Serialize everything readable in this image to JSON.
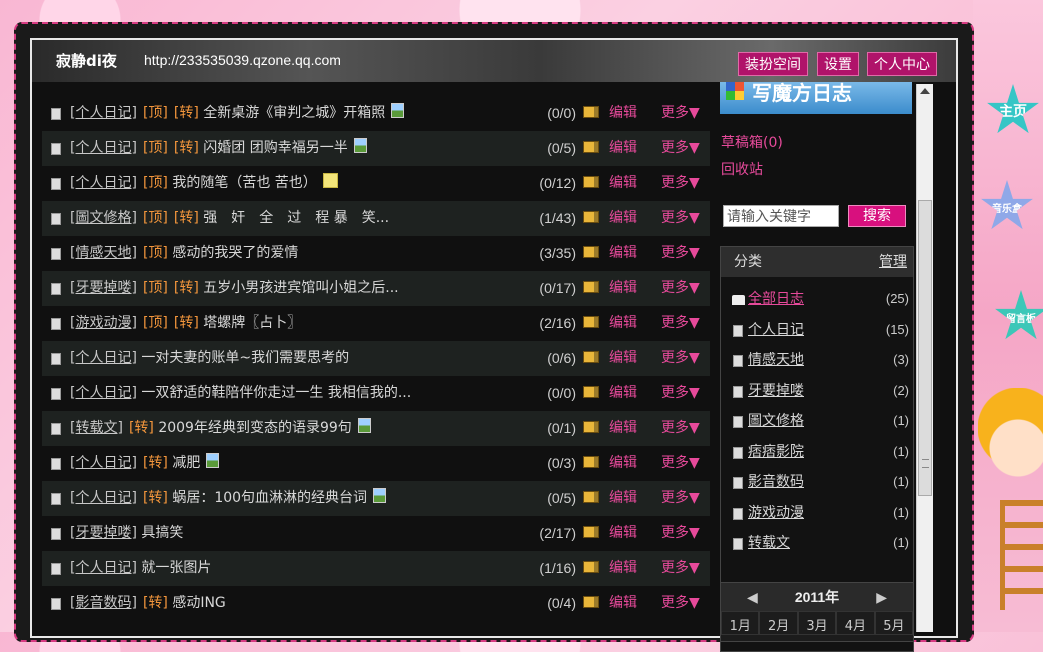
{
  "header": {
    "brand": "寂静di夜",
    "url": "http://233535039.qzone.qq.com",
    "buttons": [
      "装扮空间",
      "设置",
      "个人中心"
    ]
  },
  "nav_stars": [
    "主页",
    "音乐盒",
    "留言板"
  ],
  "blog_list": [
    {
      "category": "[个人日记]",
      "tags": [
        "[顶]",
        "[转]"
      ],
      "title": "全新桌游《审判之城》开箱照",
      "count": "(0/0)"
    },
    {
      "category": "[个人日记]",
      "tags": [
        "[顶]",
        "[转]"
      ],
      "title": "闪婚团 团购幸福另一半",
      "count": "(0/5)"
    },
    {
      "category": "[个人日记]",
      "tags": [
        "[顶]"
      ],
      "title": "我的随笔（苦也 苦也）",
      "count": "(0/12)"
    },
    {
      "category": "[圖文修格]",
      "tags": [
        "[顶]",
        "[转]"
      ],
      "title": "强　奸　全　过　程 暴　笑...",
      "count": "(1/43)"
    },
    {
      "category": "[情感天地]",
      "tags": [
        "[顶]"
      ],
      "title": "感动的我哭了的爱情",
      "count": "(3/35)"
    },
    {
      "category": "[牙要掉喽]",
      "tags": [
        "[顶]",
        "[转]"
      ],
      "title": "五岁小男孩进宾馆叫小姐之后...",
      "count": "(0/17)"
    },
    {
      "category": "[游戏动漫]",
      "tags": [
        "[顶]",
        "[转]"
      ],
      "title": "塔螺牌〖占卜〗",
      "count": "(2/16)"
    },
    {
      "category": "[个人日记]",
      "tags": [],
      "title": "一对夫妻的账单~我们需要思考的",
      "count": "(0/6)"
    },
    {
      "category": "[个人日记]",
      "tags": [],
      "title": "一双舒适的鞋陪伴你走过一生 我相信我的...",
      "count": "(0/0)"
    },
    {
      "category": "[转载文]",
      "tags": [
        "[转]"
      ],
      "title": "2009年经典到变态的语录99句",
      "count": "(0/1)"
    },
    {
      "category": "[个人日记]",
      "tags": [
        "[转]"
      ],
      "title": "减肥",
      "count": "(0/3)"
    },
    {
      "category": "[个人日记]",
      "tags": [
        "[转]"
      ],
      "title": "蜗居：100句血淋淋的经典台词",
      "count": "(0/5)"
    },
    {
      "category": "[牙要掉喽]",
      "tags": [],
      "title": "具搞笑",
      "count": "(2/17)"
    },
    {
      "category": "[个人日记]",
      "tags": [],
      "title": "就一张图片",
      "count": "(1/16)"
    },
    {
      "category": "[影音数码]",
      "tags": [
        "[转]"
      ],
      "title": "感动ING",
      "count": "(0/4)"
    }
  ],
  "row_actions": {
    "edit": "编辑",
    "more": "更多▼"
  },
  "sidebar": {
    "magic_button": "写魔方日志",
    "drafts": "草稿箱(0)",
    "recycle": "回收站",
    "search_placeholder": "请输入关键字",
    "search_button": "搜索",
    "category_title": "分类",
    "manage": "管理",
    "categories": [
      {
        "name": "全部日志",
        "count": "(25)"
      },
      {
        "name": "个人日记",
        "count": "(15)"
      },
      {
        "name": "情感天地",
        "count": "(3)"
      },
      {
        "name": "牙要掉喽",
        "count": "(2)"
      },
      {
        "name": "圖文修格",
        "count": "(1)"
      },
      {
        "name": "痞痞影院",
        "count": "(1)"
      },
      {
        "name": "影音数码",
        "count": "(1)"
      },
      {
        "name": "游戏动漫",
        "count": "(1)"
      },
      {
        "name": "转载文",
        "count": "(1)"
      }
    ],
    "calendar": {
      "year": "2011年",
      "prev": "◀",
      "next": "▶",
      "months": [
        "1月",
        "2月",
        "3月",
        "4月",
        "5月"
      ]
    }
  },
  "colors": {
    "accent": "#e74a9b",
    "tag": "#f3963c",
    "header_button": "#b0136a"
  }
}
